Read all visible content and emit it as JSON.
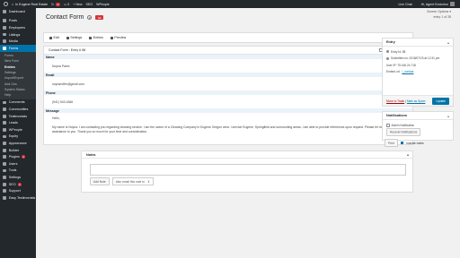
{
  "adminbar": {
    "site_name": "In Eugene Real Estate",
    "comments_count": "0",
    "updates_count": "1",
    "new_label": "New",
    "seo_label": "SEO",
    "plugin_label": "WPeople",
    "live_chat": "Live Chat",
    "greeting": "Hi, Agent Evolution"
  },
  "sidebar": {
    "items": [
      {
        "label": "Dashboard"
      },
      {
        "label": "Posts"
      },
      {
        "label": "Employees"
      },
      {
        "label": "Listings"
      },
      {
        "label": "Media"
      },
      {
        "label": "Forms"
      },
      {
        "label": "Comments"
      },
      {
        "label": "Communities"
      },
      {
        "label": "Testimonials"
      },
      {
        "label": "Leads"
      },
      {
        "label": "WPeople"
      },
      {
        "label": "Equity"
      },
      {
        "label": "Appearance"
      },
      {
        "label": "Builder"
      },
      {
        "label": "Plugins"
      },
      {
        "label": "Users"
      },
      {
        "label": "Tools"
      },
      {
        "label": "Settings"
      },
      {
        "label": "SEO"
      },
      {
        "label": "Support"
      },
      {
        "label": "Easy Testimonials"
      }
    ],
    "forms_submenu": [
      "Forms",
      "New Form",
      "Entries",
      "Settings",
      "Import/Export",
      "Add-Ons",
      "System Status",
      "Help"
    ],
    "plugins_badge": "1",
    "seo_badge": "1"
  },
  "header": {
    "screen_options": "Screen Options ▾",
    "entry_nav": "entry 1 of 28",
    "title": "Contact Form",
    "chevron": "▾",
    "form_logo": "GF"
  },
  "toolbar": {
    "edit": "Edit",
    "settings": "Settings",
    "entries": "Entries",
    "preview": "Preview"
  },
  "entry": {
    "header": "Contact Form : Entry # 58",
    "show_empty": "show empty fields",
    "fields": [
      {
        "label": "Name",
        "value": "Noyna Parez"
      },
      {
        "label": "Email",
        "value": "noynaroffer@gmail.com"
      },
      {
        "label": "Phone",
        "value": "(541) 543-4366"
      }
    ],
    "message_label": "Message",
    "message": [
      "Hello,",
      "My name is Noyna. I am contacting you regarding cleaning service. I am the owner of a Cleaning Company in Eugene Oregon area. I service Eugene, Springfield and surrounding areas. I am able to provide references upon request. Please let me know if I may be of assistance to you. Thank you so much for your time and consideration."
    ]
  },
  "notes": {
    "title": "Notes",
    "toggle": "▴",
    "add_note": "Add Note",
    "email_select": "Also email this note to",
    "select_arrow": "⇕"
  },
  "entry_box": {
    "title": "Entry",
    "toggle": "▴",
    "entry_id": "Entry Id: 58",
    "submitted": "Submitted on: 2018/07/23 at 12:31 pm",
    "user_ip": "User IP: 75.160.24.718",
    "embed_label": "Embed url:",
    "embed_link": "/_contact",
    "trash": "Move to Trash",
    "mark_spam": "Mark as Spam",
    "update": "Update"
  },
  "notifications_box": {
    "title": "Notifications",
    "toggle": "▴",
    "admin_notification": "Admin Notification",
    "resend": "Resend Notifications"
  },
  "print": {
    "button": "Print",
    "include_notes": "include notes"
  }
}
